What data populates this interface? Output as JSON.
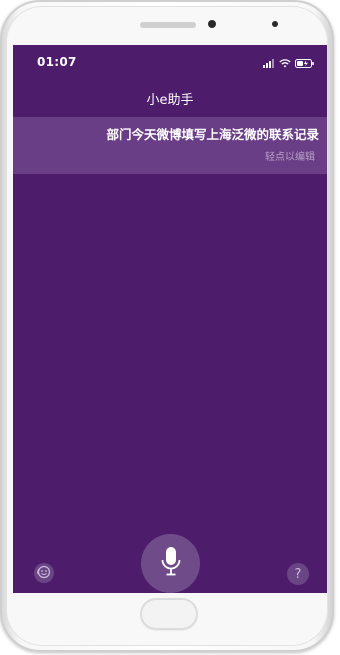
{
  "status_bar": {
    "time": "01:07",
    "icons": [
      "signal-icon",
      "wifi-icon",
      "battery-icon"
    ]
  },
  "header": {
    "title": "小e助手"
  },
  "utterance": {
    "text": "部门今天微博填写上海泛微的联系记录",
    "edit_hint": "轻点以编辑"
  },
  "bottom_bar": {
    "left_icon": "assistant-face-icon",
    "mic_icon": "microphone-icon",
    "help_label": "?"
  },
  "colors": {
    "screen_background": "#4d1c6b",
    "utterance_background": "#6a3e86",
    "mic_button": "#6f4b8a"
  }
}
